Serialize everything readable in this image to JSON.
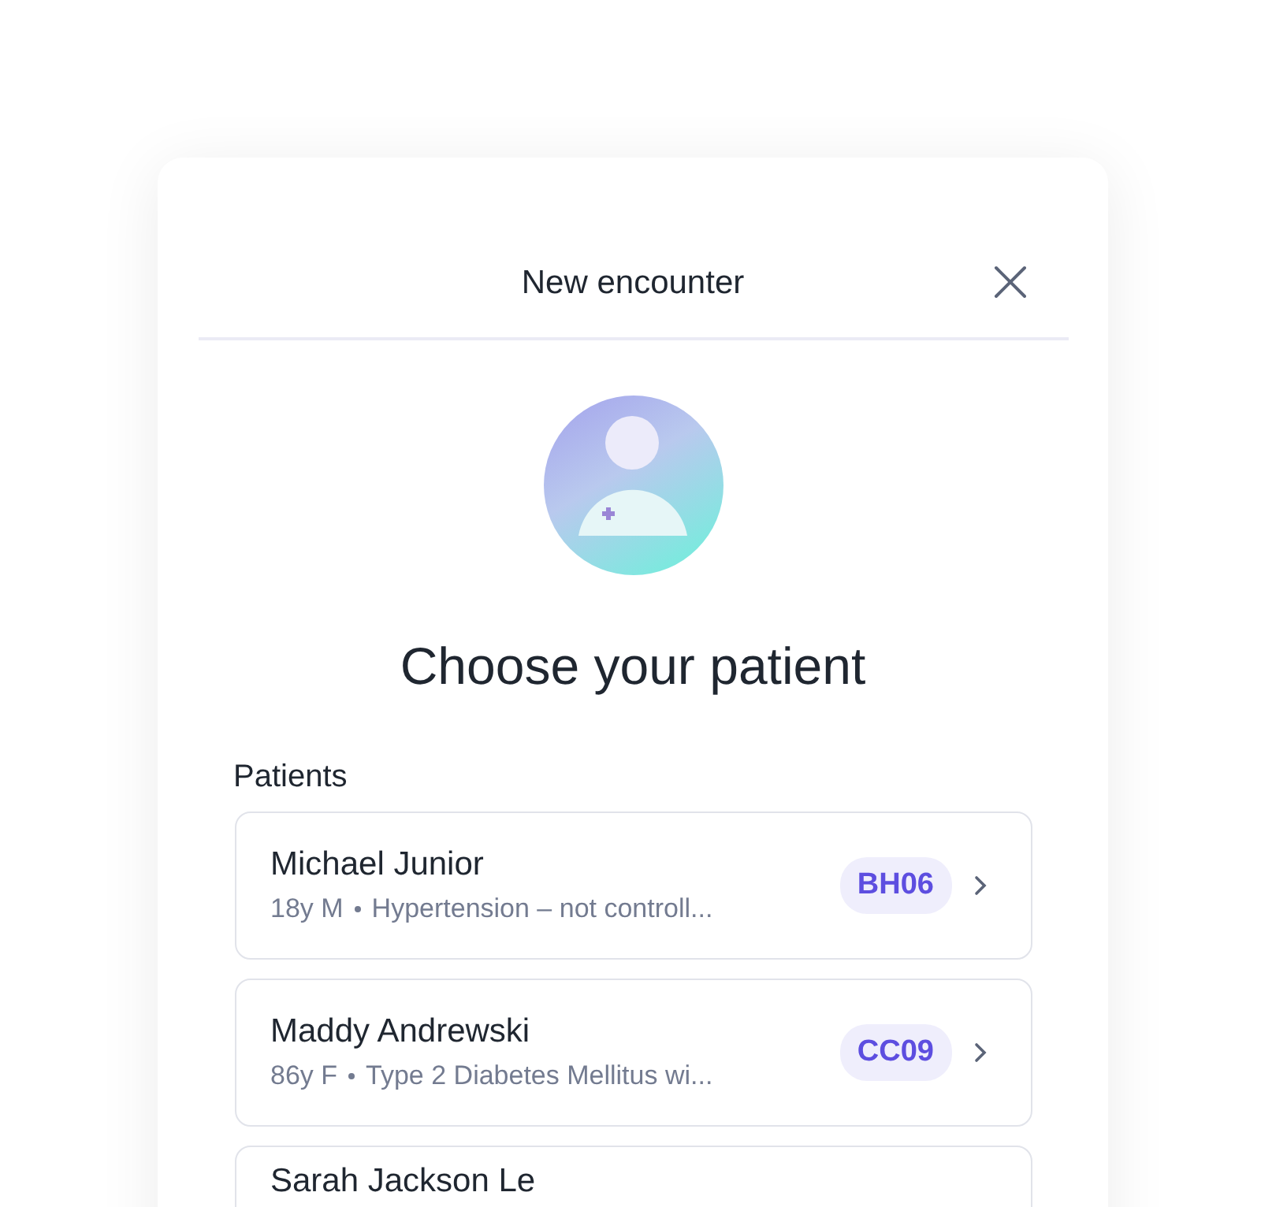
{
  "dialog": {
    "title": "New encounter",
    "heading": "Choose your patient"
  },
  "patients_label": "Patients",
  "patients": [
    {
      "name": "Michael Junior",
      "details": "18y M",
      "condition": "Hypertension – not controll...",
      "code": "BH06"
    },
    {
      "name": "Maddy Andrewski",
      "details": "86y F",
      "condition": "Type 2 Diabetes Mellitus wi...",
      "code": "CC09"
    },
    {
      "name": "Sarah Jackson Le"
    }
  ]
}
